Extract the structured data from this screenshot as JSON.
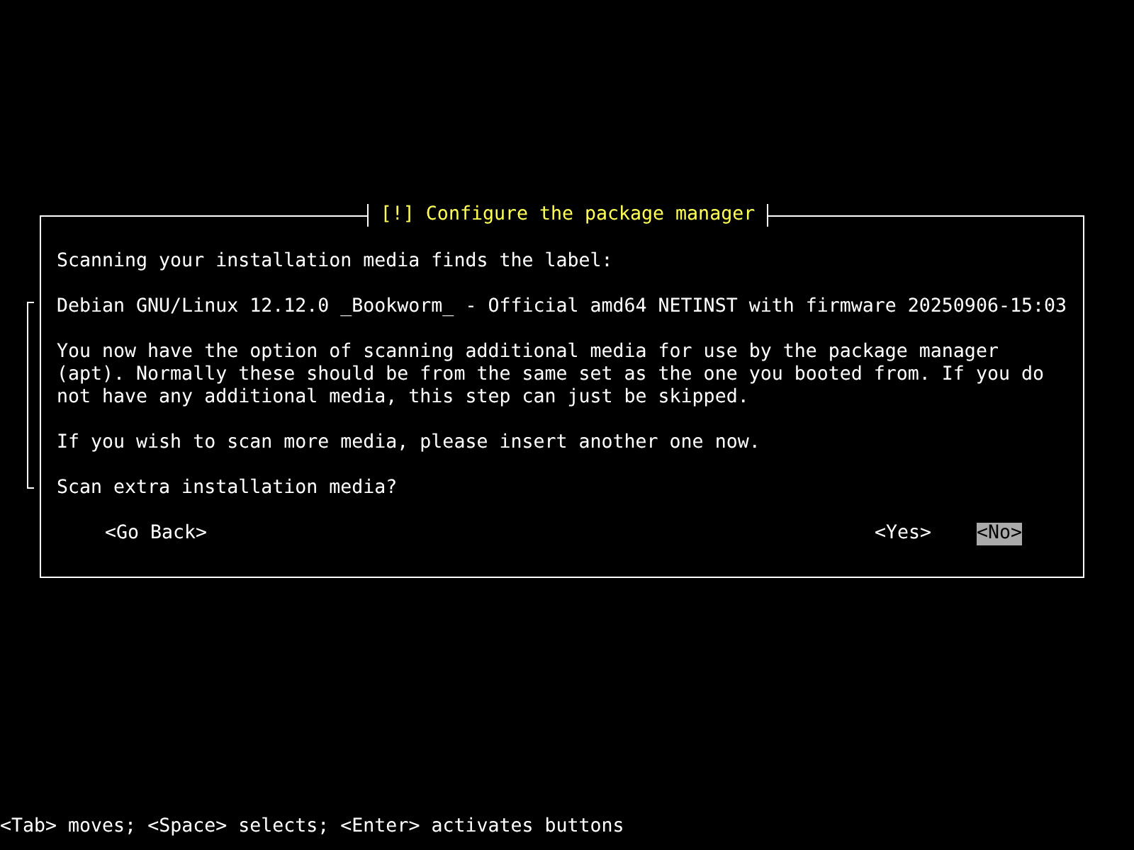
{
  "dialog": {
    "title": "[!] Configure the package manager",
    "paragraphs": [
      {
        "kind": "text",
        "text": "Scanning your installation media finds the label:"
      },
      {
        "kind": "label",
        "text": "Debian GNU/Linux 12.12.0 _Bookworm_ - Official amd64 NETINST with firmware 20250906-15:03"
      },
      {
        "kind": "text",
        "text": "You now have the option of scanning additional media for use by the package manager (apt). Normally these should be from the same set as the one you booted from. If you do not have any additional media, this step can just be skipped."
      },
      {
        "kind": "text",
        "text": "If you wish to scan more media, please insert another one now."
      },
      {
        "kind": "text",
        "text": "Scan extra installation media?"
      }
    ],
    "buttons": [
      {
        "label": "<Go Back>",
        "selected": false
      },
      {
        "label": "<Yes>",
        "selected": false
      },
      {
        "label": "<No>",
        "selected": true
      }
    ]
  },
  "help": "<Tab> moves; <Space> selects; <Enter> activates buttons"
}
